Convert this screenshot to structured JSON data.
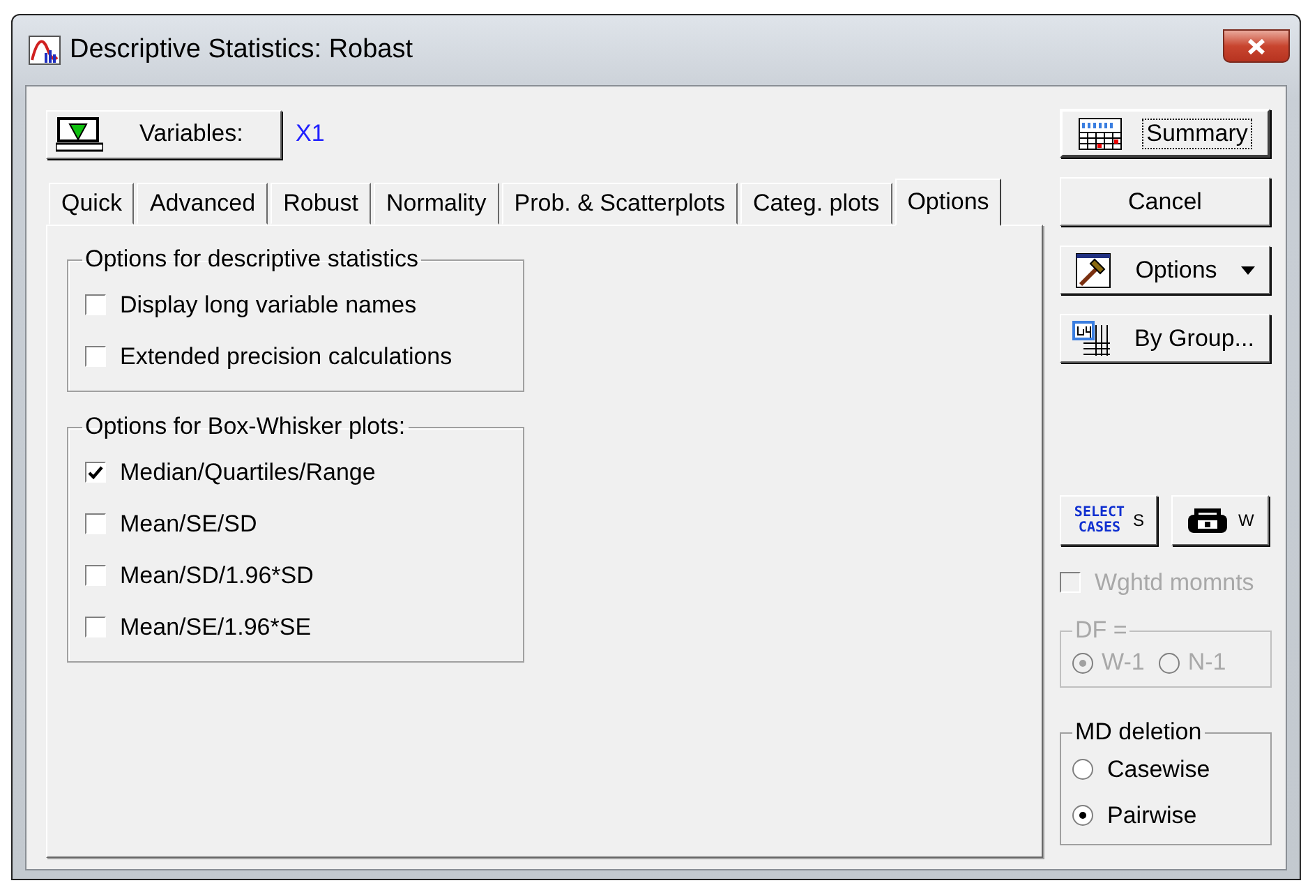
{
  "window": {
    "title": "Descriptive Statistics: Robast"
  },
  "variables": {
    "button": "Variables:",
    "value": "X1"
  },
  "tabs": [
    {
      "label": "Quick",
      "selected": false
    },
    {
      "label": "Advanced",
      "selected": false
    },
    {
      "label": "Robust",
      "selected": false
    },
    {
      "label": "Normality",
      "selected": false
    },
    {
      "label": "Prob. & Scatterplots",
      "selected": false
    },
    {
      "label": "Categ. plots",
      "selected": false
    },
    {
      "label": "Options",
      "selected": true
    }
  ],
  "groups": [
    {
      "title": "Options for descriptive statistics",
      "options": [
        {
          "label": "Display long variable names",
          "checked": false
        },
        {
          "label": "Extended precision calculations",
          "checked": false
        }
      ]
    },
    {
      "title": "Options for Box-Whisker plots:",
      "options": [
        {
          "label": "Median/Quartiles/Range",
          "checked": true
        },
        {
          "label": "Mean/SE/SD",
          "checked": false
        },
        {
          "label": "Mean/SD/1.96*SD",
          "checked": false
        },
        {
          "label": "Mean/SE/1.96*SE",
          "checked": false
        }
      ]
    }
  ],
  "buttons": [
    {
      "kind": "summary",
      "label": "Summary",
      "focused": true
    },
    {
      "kind": "plain",
      "label": "Cancel",
      "focused": false
    },
    {
      "kind": "options",
      "label": "Options",
      "focused": false
    },
    {
      "kind": "bygroup",
      "label": "By Group...",
      "focused": false
    }
  ],
  "small_buttons": [
    {
      "kind": "select",
      "icon_text": "SELECT CASES",
      "label": "S"
    },
    {
      "kind": "weight",
      "label": "W"
    }
  ],
  "weighted": {
    "label": "Wghtd momnts",
    "checked": false,
    "disabled": true
  },
  "df": {
    "title": "DF =",
    "disabled": true,
    "options": [
      {
        "label": "W-1",
        "selected": true
      },
      {
        "label": "N-1",
        "selected": false
      }
    ]
  },
  "md_deletion": {
    "title": "MD deletion",
    "disabled": false,
    "options": [
      {
        "label": "Casewise",
        "selected": false
      },
      {
        "label": "Pairwise",
        "selected": true
      }
    ]
  }
}
